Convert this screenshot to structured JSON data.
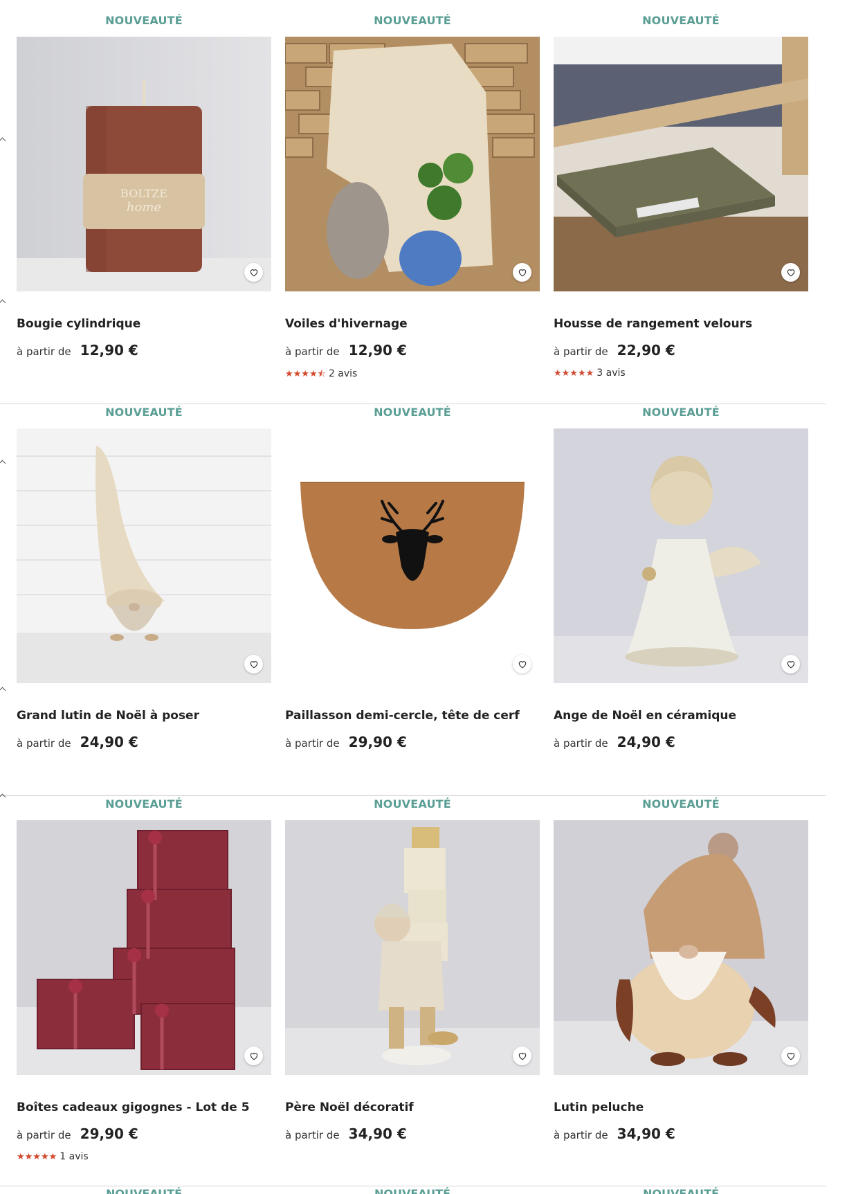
{
  "colors": {
    "badge": "#5a9e94",
    "stars": "#d3472c",
    "divider": "#d5d5d5"
  },
  "products": [
    {
      "badge": "NOUVEAUTÉ",
      "title": "Bougie cylindrique",
      "from_label": "à partir de",
      "price": "12,90 €",
      "rating": null,
      "reviews": "",
      "image": "candle",
      "favorite_icon": "heart-icon"
    },
    {
      "badge": "NOUVEAUTÉ",
      "title": "Voiles d'hivernage",
      "from_label": "à partir de",
      "price": "12,90 €",
      "rating": 4.5,
      "reviews": "2 avis",
      "image": "winter-veil",
      "favorite_icon": "heart-icon"
    },
    {
      "badge": "NOUVEAUTÉ",
      "title": "Housse de rangement velours",
      "from_label": "à partir de",
      "price": "22,90 €",
      "rating": 5,
      "reviews": "3 avis",
      "image": "storage-bag",
      "favorite_icon": "heart-icon"
    },
    {
      "badge": "NOUVEAUTÉ",
      "title": "Grand lutin de Noël à poser",
      "from_label": "à partir de",
      "price": "24,90 €",
      "rating": null,
      "reviews": "",
      "image": "gnome",
      "favorite_icon": "heart-icon"
    },
    {
      "badge": "NOUVEAUTÉ",
      "title": "Paillasson demi-cercle, tête de cerf",
      "from_label": "à partir de",
      "price": "29,90 €",
      "rating": null,
      "reviews": "",
      "image": "doormat",
      "favorite_icon": "heart-icon"
    },
    {
      "badge": "NOUVEAUTÉ",
      "title": "Ange de Noël en céramique",
      "from_label": "à partir de",
      "price": "24,90 €",
      "rating": null,
      "reviews": "",
      "image": "angel",
      "favorite_icon": "heart-icon"
    },
    {
      "badge": "NOUVEAUTÉ",
      "title": "Boîtes cadeaux gigognes - Lot de 5",
      "from_label": "à partir de",
      "price": "29,90 €",
      "rating": 5,
      "reviews": "1 avis",
      "image": "gift-boxes",
      "favorite_icon": "heart-icon"
    },
    {
      "badge": "NOUVEAUTÉ",
      "title": "Père Noël décoratif",
      "from_label": "à partir de",
      "price": "34,90 €",
      "rating": null,
      "reviews": "",
      "image": "santa",
      "favorite_icon": "heart-icon"
    },
    {
      "badge": "NOUVEAUTÉ",
      "title": "Lutin peluche",
      "from_label": "à partir de",
      "price": "34,90 €",
      "rating": null,
      "reviews": "",
      "image": "plush-gnome",
      "favorite_icon": "heart-icon"
    }
  ],
  "next_row_badges": [
    "NOUVEAUTÉ",
    "NOUVEAUTÉ",
    "NOUVEAUTÉ"
  ]
}
